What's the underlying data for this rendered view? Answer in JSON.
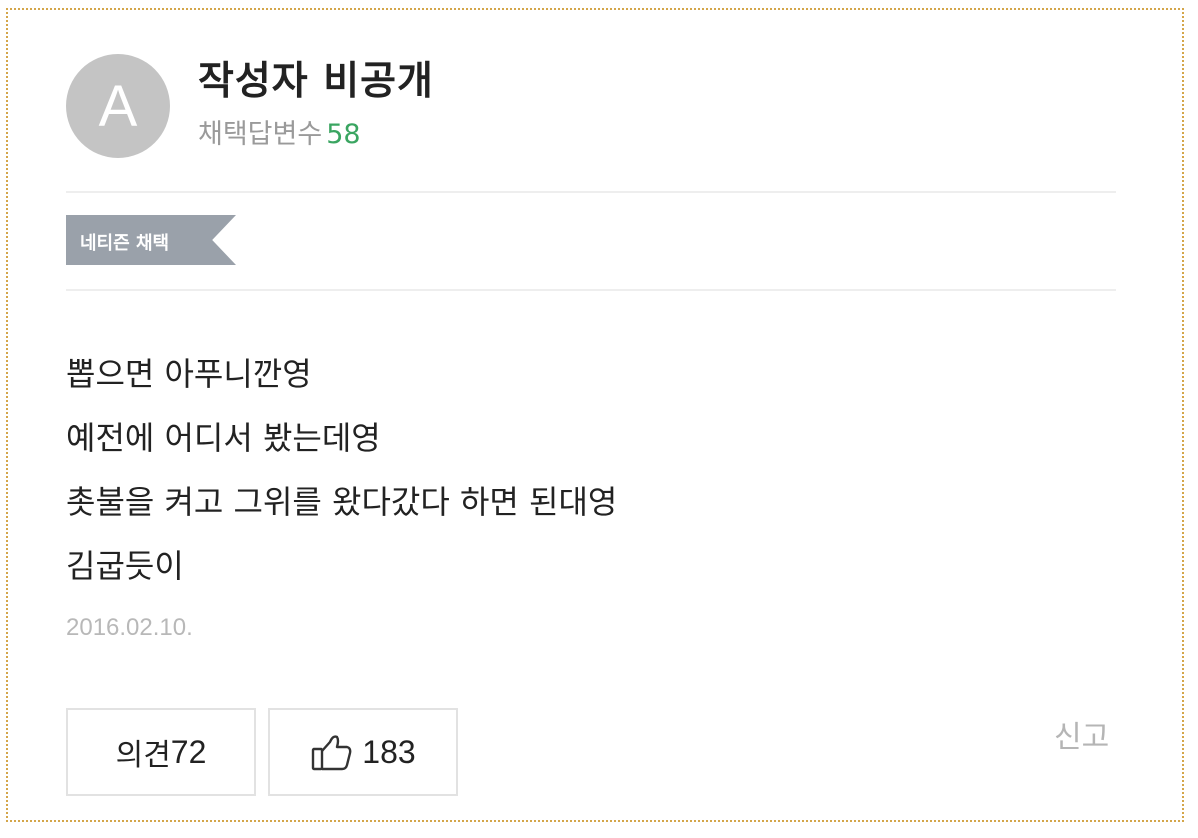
{
  "author": {
    "avatar_letter": "A",
    "name": "작성자 비공개",
    "adopted_label": "채택답변수",
    "adopted_count": "58"
  },
  "badge": {
    "label": "네티즌 채택"
  },
  "answer": {
    "lines": [
      "뽑으면 아푸니깐영",
      "예전에 어디서 봤는데영",
      "촛불을 켜고 그위를 왔다갔다 하면 된대영",
      "김굽듯이"
    ],
    "date": "2016.02.10."
  },
  "actions": {
    "comment_label": "의견",
    "comment_count": "72",
    "like_icon": "thumbs-up-icon",
    "like_count": "183",
    "report_label": "신고"
  },
  "colors": {
    "frame_border": "#d4a64a",
    "accent_green": "#3aa561",
    "badge_bg": "#9aa1aa"
  }
}
